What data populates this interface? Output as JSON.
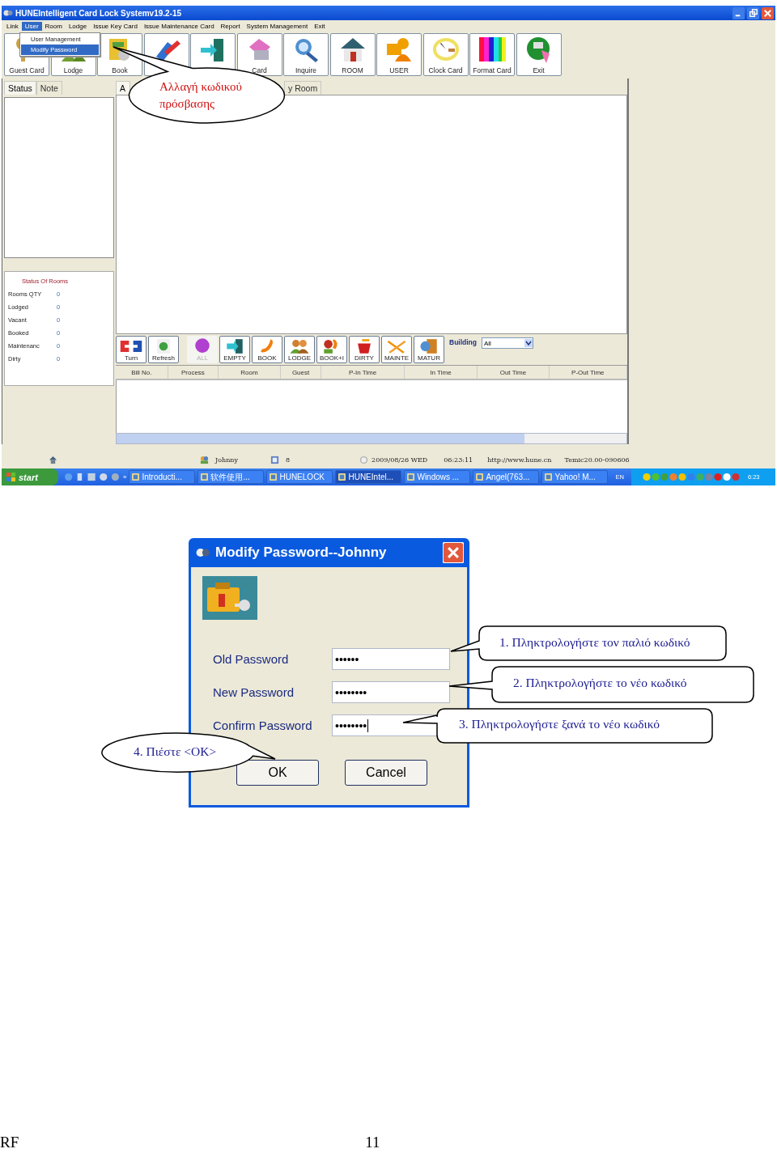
{
  "window": {
    "title": "HUNEIntelligent Card Lock Systemv19.2-15"
  },
  "menu": [
    {
      "label": "Link",
      "selected": false
    },
    {
      "label": "User",
      "selected": true
    },
    {
      "label": "Room",
      "selected": false
    },
    {
      "label": "Lodge",
      "selected": false
    },
    {
      "label": "Issue Key Card",
      "selected": false
    },
    {
      "label": "Issue Maintenance Card",
      "selected": false
    },
    {
      "label": "Report",
      "selected": false
    },
    {
      "label": "System Management",
      "selected": false
    },
    {
      "label": "Exit",
      "selected": false
    }
  ],
  "user_menu": [
    {
      "label": "User Management",
      "selected": false
    },
    {
      "label": "Modify Password",
      "selected": true
    }
  ],
  "toolbar": [
    {
      "kind": "labeled",
      "label": "Guest Card"
    },
    {
      "kind": "labeled",
      "label": "Lodge"
    },
    {
      "kind": "labeled",
      "label": "Book"
    },
    {
      "kind": "icon_only"
    },
    {
      "kind": "icon_only"
    },
    {
      "kind": "labeled",
      "label": "Card"
    },
    {
      "kind": "labeled",
      "label": "Inquire"
    },
    {
      "kind": "labeled",
      "label": "ROOM"
    },
    {
      "kind": "labeled",
      "label": "USER"
    },
    {
      "kind": "labeled",
      "label": "Clock Card"
    },
    {
      "kind": "labeled",
      "label": "Format Card"
    },
    {
      "kind": "labeled",
      "label": "Exit"
    }
  ],
  "left_tabs": [
    {
      "label": "Status",
      "selected": true
    },
    {
      "label": "Note",
      "selected": false
    }
  ],
  "room_status": {
    "title": "Status Of Rooms",
    "rows": [
      {
        "label": "Rooms QTY",
        "value": "0"
      },
      {
        "label": "Lodged",
        "value": "0"
      },
      {
        "label": "Vacant",
        "value": "0"
      },
      {
        "label": "Booked",
        "value": "0"
      },
      {
        "label": "Maintenanc",
        "value": "0"
      },
      {
        "label": "Dirty",
        "value": "0"
      }
    ]
  },
  "main_tabs": [
    {
      "label": "A",
      "selected": true
    },
    {
      "label": "y Room",
      "selected": false
    }
  ],
  "room_buttons": [
    {
      "label": "Turn",
      "disabled": false
    },
    {
      "label": "Refresh",
      "disabled": false
    },
    {
      "label": "ALL",
      "disabled": true
    },
    {
      "label": "EMPTY",
      "disabled": false
    },
    {
      "label": "BOOK",
      "disabled": false
    },
    {
      "label": "LODGE",
      "disabled": false
    },
    {
      "label": "BOOK+I",
      "disabled": false
    },
    {
      "label": "DIRTY",
      "disabled": false
    },
    {
      "label": "MAINTE",
      "disabled": false
    },
    {
      "label": "MATUR",
      "disabled": false
    }
  ],
  "building": {
    "label": "Building",
    "value": "All"
  },
  "table": {
    "columns": [
      "Bill No.",
      "Process",
      "Room",
      "Guest",
      "P-In Time",
      "In Time",
      "Out Time",
      "P-Out Time"
    ]
  },
  "status_bar": {
    "user": "Johnny",
    "count": "8",
    "date": "2009/08/26 WED",
    "time": "06:23:11",
    "url": "http://www.hune.cn",
    "version": "Temic20.00-090606"
  },
  "taskbar": {
    "start": "start",
    "more": "»",
    "tasks": [
      {
        "label": "Introducti...",
        "selected": false
      },
      {
        "label": "软件使用...",
        "selected": false
      },
      {
        "label": "HUNELOCK",
        "selected": false
      },
      {
        "label": "HUNEIntel...",
        "selected": true
      },
      {
        "label": "Windows ...",
        "selected": false
      },
      {
        "label": "Angel(763...",
        "selected": false
      },
      {
        "label": "Yahoo! M...",
        "selected": false
      }
    ],
    "language": "EN",
    "clock": "6:23"
  },
  "top_callout": {
    "text": "Αλλαγή κωδικού πρόσβασης"
  },
  "dialog": {
    "title": "Modify Password--Johnny",
    "fields": [
      {
        "label": "Old Password",
        "value": "••••••",
        "focused": false
      },
      {
        "label": "New Password",
        "value": "••••••••",
        "focused": false
      },
      {
        "label": "Confirm Password",
        "value": "••••••••",
        "focused": true
      }
    ],
    "buttons": [
      "OK",
      "Cancel"
    ]
  },
  "dialog_callouts": [
    {
      "text": "1. Πληκτρολογήστε τον παλιό κωδικό"
    },
    {
      "text": "2. Πληκτρολογήστε το νέο κωδικό"
    },
    {
      "text": "3. Πληκτρολογήστε ξανά το νέο κωδικό"
    },
    {
      "text": "4. Πιέστε <OK>"
    }
  ],
  "page_footer": {
    "left": "RF",
    "page_number": "11"
  }
}
